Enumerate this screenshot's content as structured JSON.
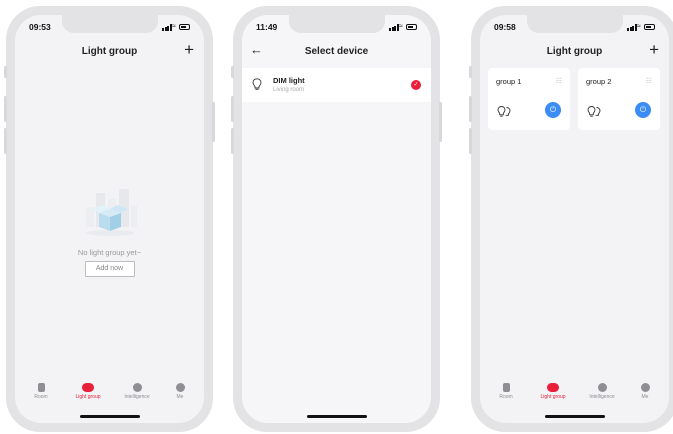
{
  "phones": [
    {
      "time": "09:53",
      "title": "Light group",
      "add_button": "+",
      "empty_text": "No light group yet~",
      "add_now": "Add now",
      "tabs": [
        "Room",
        "Light group",
        "Intelligence",
        "Me"
      ],
      "active_tab": "Light group"
    },
    {
      "time": "11:49",
      "title": "Select device",
      "back_icon": "←",
      "device": {
        "name": "DIM light",
        "room": "Living room",
        "selected": true
      }
    },
    {
      "time": "09:58",
      "title": "Light group",
      "add_button": "+",
      "groups": [
        {
          "name": "group 1"
        },
        {
          "name": "group 2"
        }
      ],
      "tabs": [
        "Room",
        "Light group",
        "Intelligence",
        "Me"
      ],
      "active_tab": "Light group"
    }
  ],
  "colors": {
    "accent": "#e8203a",
    "power": "#3b8cf5",
    "frame": "#e3e3e5",
    "screen": "#f3f3f5"
  },
  "icons": {
    "check": "✓",
    "power": "⏻",
    "menu": "☷",
    "wifi": "≈"
  }
}
